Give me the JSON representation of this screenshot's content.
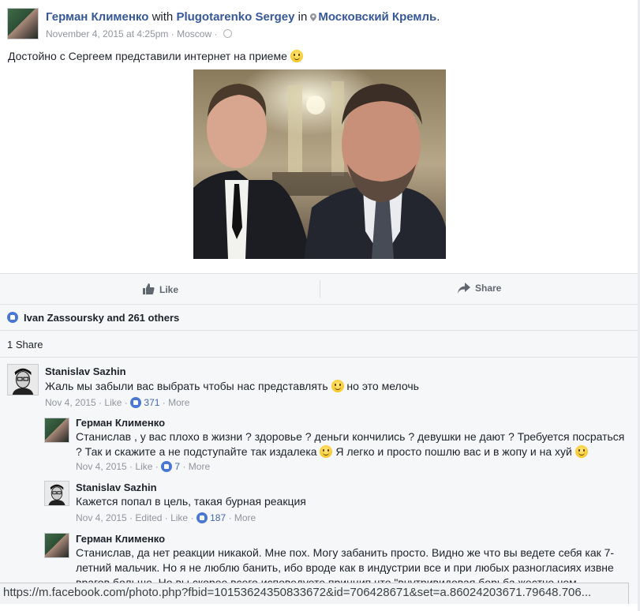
{
  "post": {
    "author": "Герман Клименко",
    "with_word": "with",
    "tagged": "Plugotarenko Sergey",
    "in_word": "in",
    "place": "Московский Кремль",
    "period": ".",
    "date": "November 4, 2015 at 4:25pm",
    "separator": "·",
    "location": "Moscow",
    "text": "Достойно с Сергеем представили интернет на приеме"
  },
  "actions": {
    "like_label": "Like",
    "share_label": "Share"
  },
  "reactions": {
    "likes_text": "Ivan Zassoursky and 261 others",
    "shares_text": "1 Share"
  },
  "comments": [
    {
      "author": "Stanislav Sazhin",
      "text_before": "Жаль мы забыли вас выбрать чтобы нас представлять",
      "text_after": "но это мелочь",
      "date": "Nov 4, 2015",
      "like": "Like",
      "count": "371",
      "more": "More"
    },
    {
      "author": "Герман Клименко",
      "line1": "Станислав , у вас плохо в жизни ? здоровье ? деньги кончились ? девушки не дают ? Требуется посраться",
      "line2_before": "? Так и скажите а не подступайте так издалека",
      "line2_after": "Я легко и просто пошлю вас и в жопу и на хуй",
      "date": "Nov 4, 2015",
      "like": "Like",
      "count": "7",
      "more": "More"
    },
    {
      "author": "Stanislav Sazhin",
      "text": "Кажется попал в цель, такая бурная реакция",
      "date": "Nov 4, 2015",
      "edited": "Edited",
      "like": "Like",
      "count": "187",
      "more": "More"
    },
    {
      "author": "Герман Клименко",
      "line1": "Станислав, да нет реакции никакой. Мне пох. Могу забанить просто. Видно же что вы ведете себя как 7-",
      "line2": "летний мальчик. Но я не люблю банить, ибо вроде как в индустрии все и при любых разногласиях извне",
      "line3": "врагов больше. Но вы скорее всего исповедуете принцип что \"внутривидовая борьба жестче чем"
    }
  ],
  "statusbar": {
    "url": "https://m.facebook.com/photo.php?fbid=10153624350833672&id=706428671&set=a.86024203671.79648.706..."
  },
  "colors": {
    "link": "#365899",
    "like_blue": "#4267b2",
    "meta_gray": "#90949c"
  }
}
